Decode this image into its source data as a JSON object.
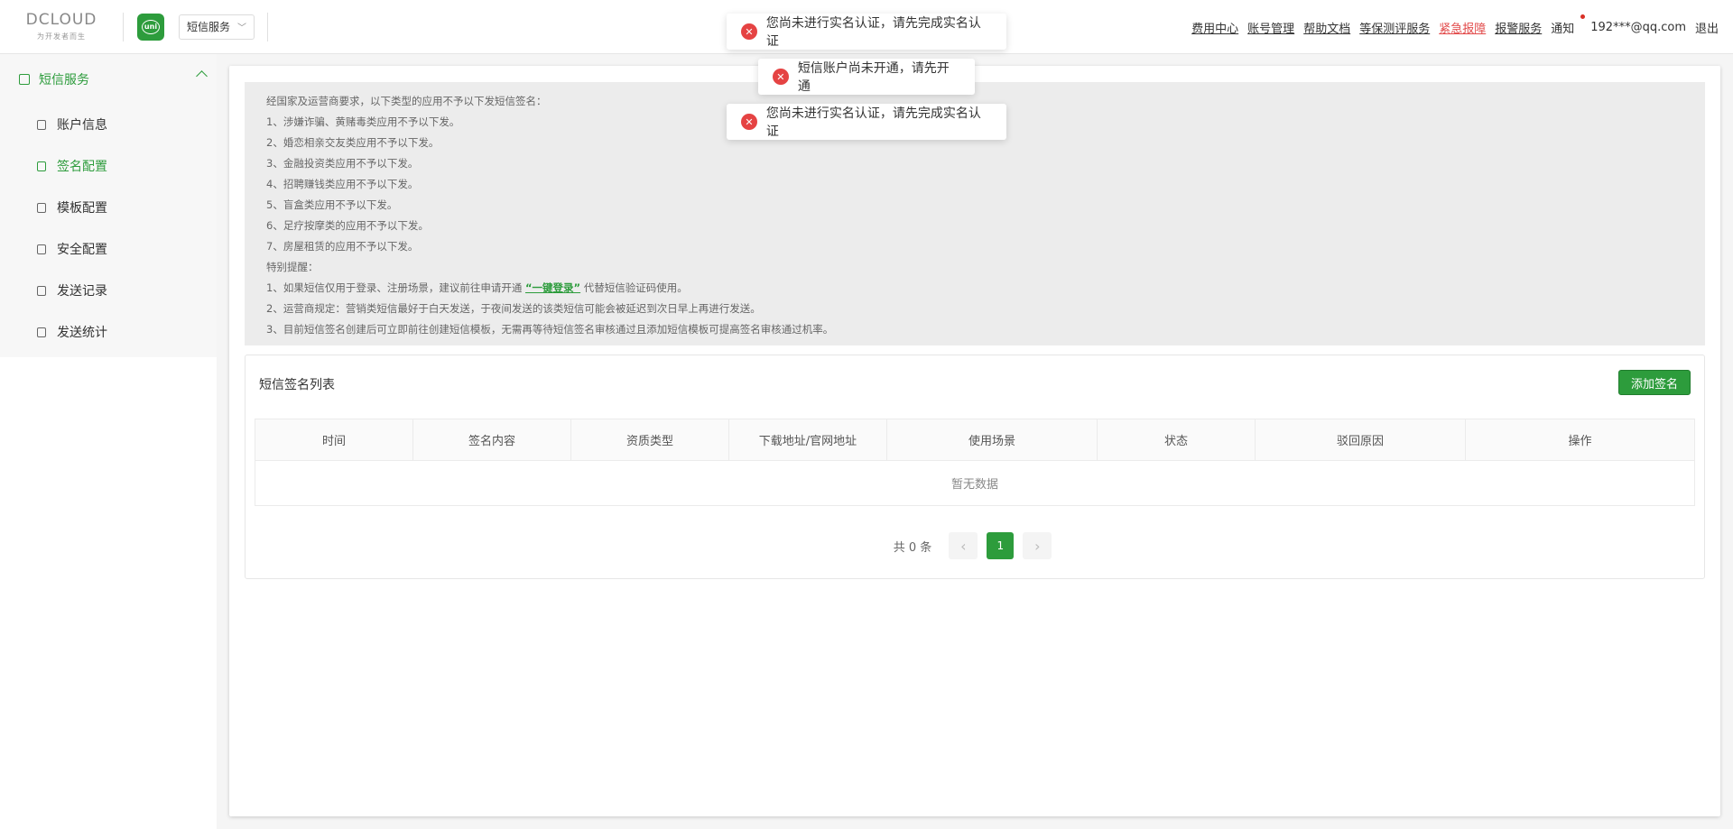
{
  "header": {
    "logo_text_main": "DCLOUD",
    "logo_text_sub": "为开发者而生",
    "service_select": "短信服务",
    "links": {
      "fee_center": "费用中心",
      "account_mgmt": "账号管理",
      "help_docs": "帮助文档",
      "security_eval": "等保测评服务",
      "emergency_report": "紧急报障",
      "alarm_service": "报警服务",
      "notify": "通知",
      "email": "192***@qq.com",
      "logout": "退出"
    }
  },
  "sidebar": {
    "group": "短信服务",
    "items": [
      {
        "label": "账户信息",
        "active": false
      },
      {
        "label": "签名配置",
        "active": true
      },
      {
        "label": "模板配置",
        "active": false
      },
      {
        "label": "安全配置",
        "active": false
      },
      {
        "label": "发送记录",
        "active": false
      },
      {
        "label": "发送统计",
        "active": false
      }
    ]
  },
  "notice": {
    "intro": "经国家及运营商要求，以下类型的应用不予以下发短信签名：",
    "rules": [
      "1、涉嫌诈骗、黄赌毒类应用不予以下发。",
      "2、婚恋相亲交友类应用不予以下发。",
      "3、金融投资类应用不予以下发。",
      "4、招聘赚钱类应用不予以下发。",
      "5、盲盒类应用不予以下发。",
      "6、足疗按摩类的应用不予以下发。",
      "7、房屋租赁的应用不予以下发。"
    ],
    "special_title": "特别提醒：",
    "tip1_prefix": "1、如果短信仅用于登录、注册场景，建议前往申请开通",
    "tip1_link": "“一键登录”",
    "tip1_suffix": "代替短信验证码使用。",
    "tip2": "2、运营商规定：营销类短信最好于白天发送，于夜间发送的该类短信可能会被延迟到次日早上再进行发送。",
    "tip3": "3、目前短信签名创建后可立即前往创建短信模板，无需再等待短信签名审核通过且添加短信模板可提高签名审核通过机率。"
  },
  "list": {
    "title": "短信签名列表",
    "add_button": "添加签名",
    "columns": [
      "时间",
      "签名内容",
      "资质类型",
      "下载地址/官网地址",
      "使用场景",
      "状态",
      "驳回原因",
      "操作"
    ],
    "empty_text": "暂无数据",
    "pagination": {
      "total_text": "共 0 条",
      "current_page": "1",
      "prev_icon": "‹",
      "next_icon": "›"
    }
  },
  "toasts": [
    "您尚未进行实名认证，请先完成实名认证",
    "短信账户尚未开通，请先开通",
    "您尚未进行实名认证，请先完成实名认证"
  ],
  "colors": {
    "brand": "#2d9c3c",
    "error": "#e54343",
    "alert_link": "#e24b4b"
  }
}
